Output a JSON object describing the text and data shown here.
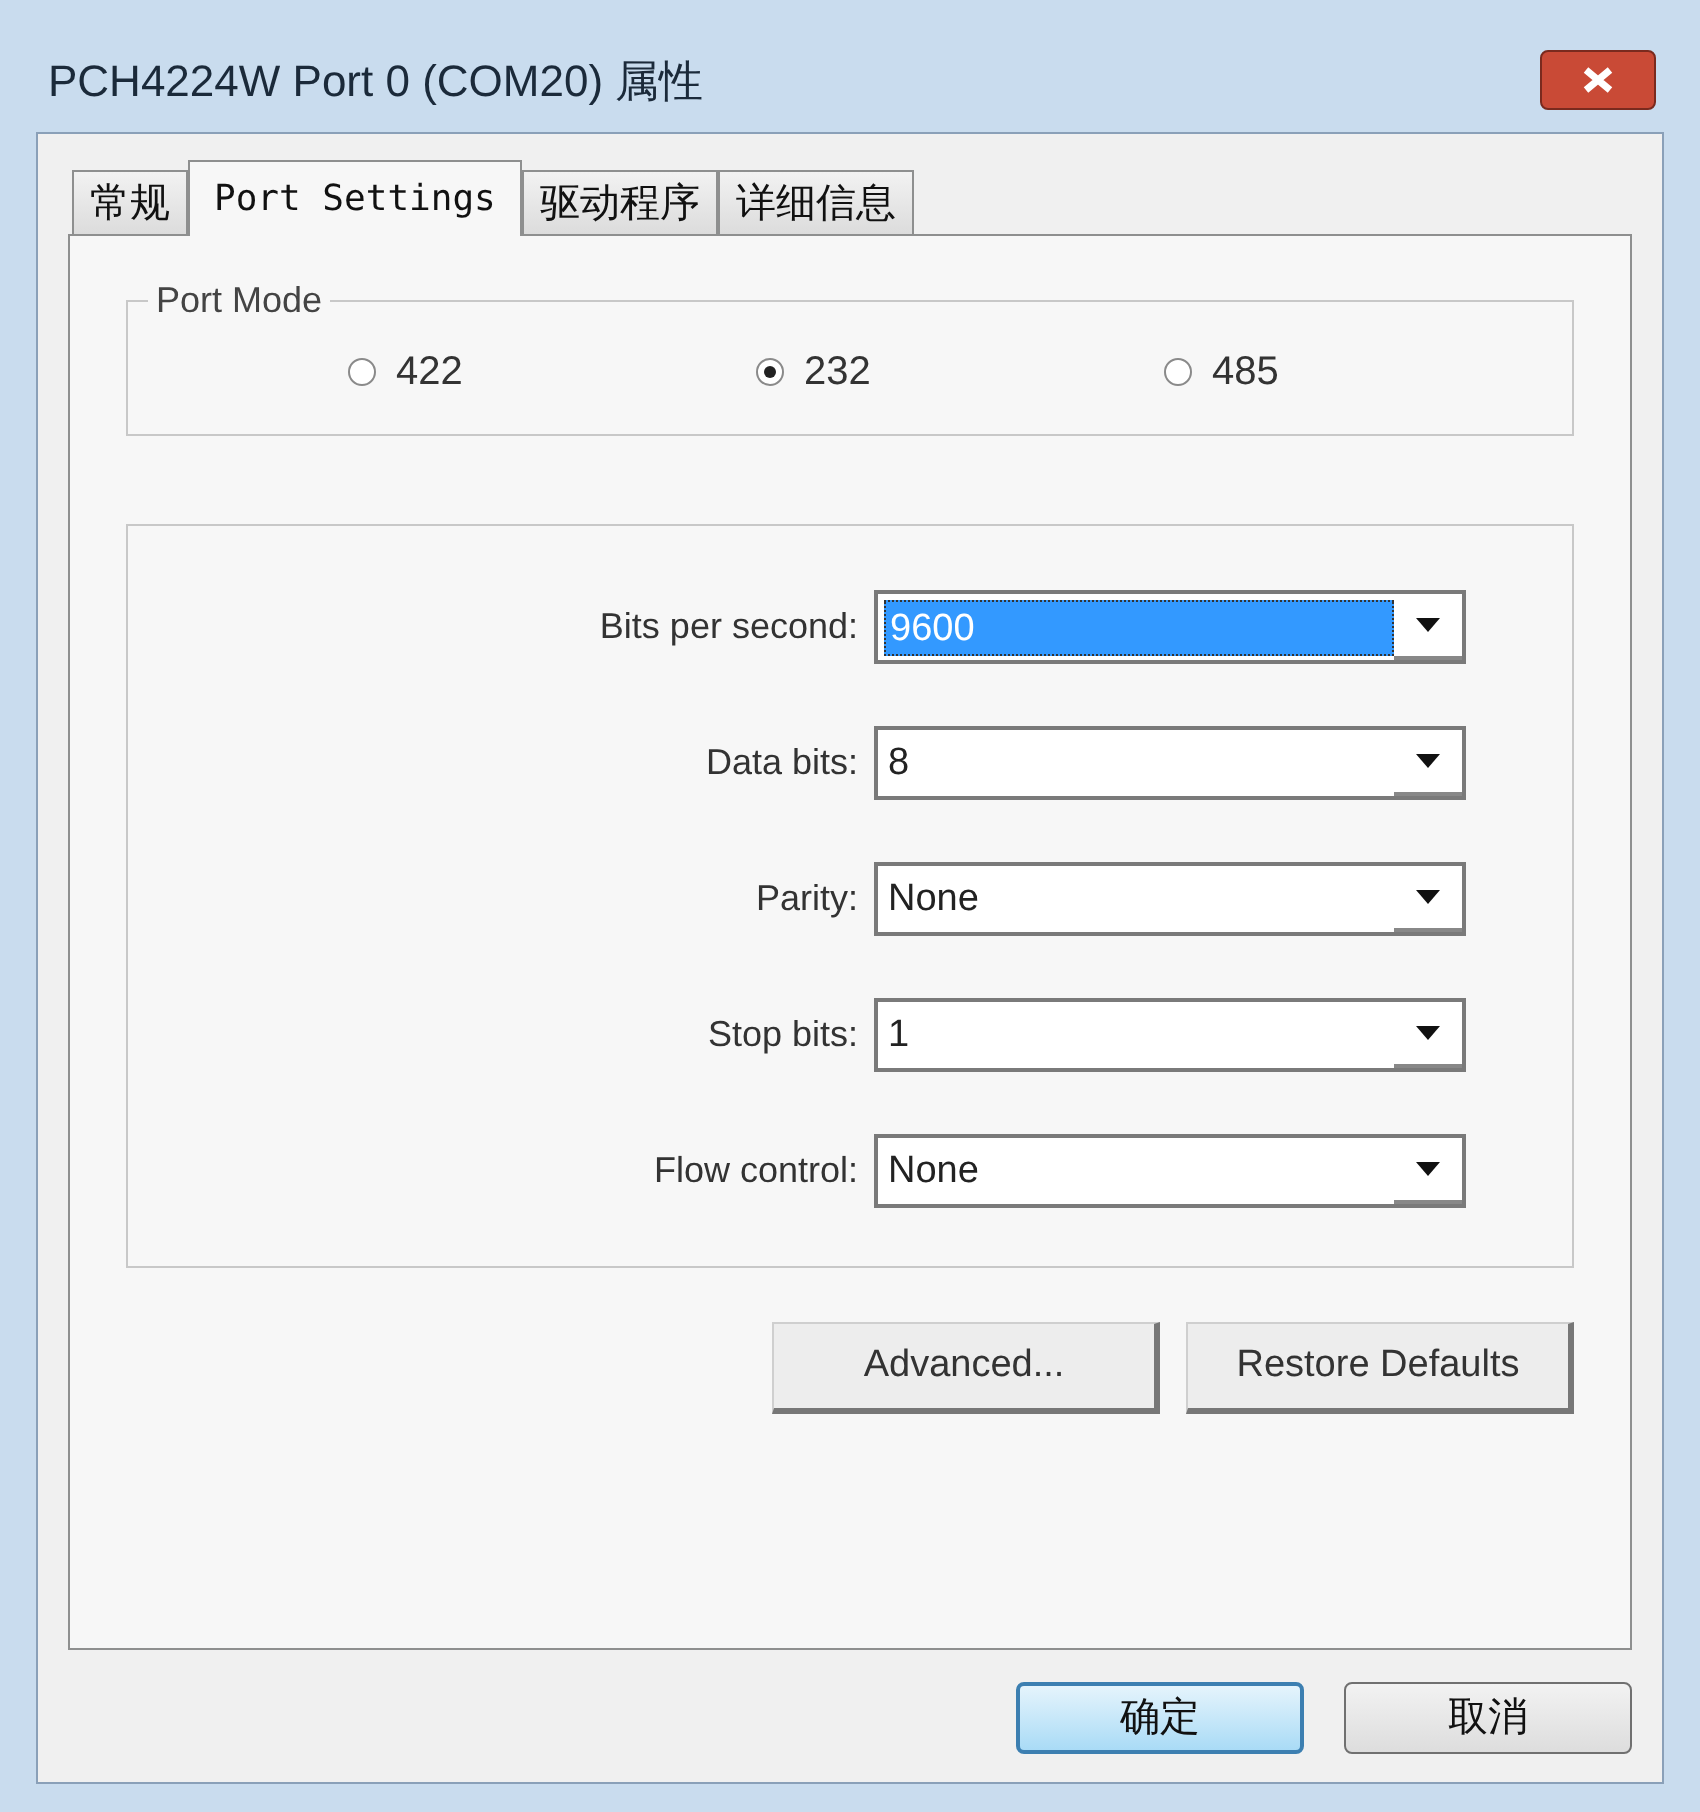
{
  "window": {
    "title": "PCH4224W Port 0 (COM20) 属性"
  },
  "tabs": [
    {
      "label": "常规",
      "selected": false
    },
    {
      "label": "Port Settings",
      "selected": true
    },
    {
      "label": "驱动程序",
      "selected": false
    },
    {
      "label": "详细信息",
      "selected": false
    }
  ],
  "port_mode": {
    "title": "Port Mode",
    "options": [
      {
        "label": "422",
        "selected": false
      },
      {
        "label": "232",
        "selected": true
      },
      {
        "label": "485",
        "selected": false
      }
    ]
  },
  "settings": [
    {
      "label": "Bits per second:",
      "value": "9600",
      "focused": true
    },
    {
      "label": "Data bits:",
      "value": "8",
      "focused": false
    },
    {
      "label": "Parity:",
      "value": "None",
      "focused": false
    },
    {
      "label": "Stop bits:",
      "value": "1",
      "focused": false
    },
    {
      "label": "Flow control:",
      "value": "None",
      "focused": false
    }
  ],
  "panel_buttons": [
    "Advanced...",
    "Restore Defaults"
  ],
  "dialog_buttons": [
    {
      "label": "确定",
      "default": true
    },
    {
      "label": "取消",
      "default": false
    }
  ]
}
